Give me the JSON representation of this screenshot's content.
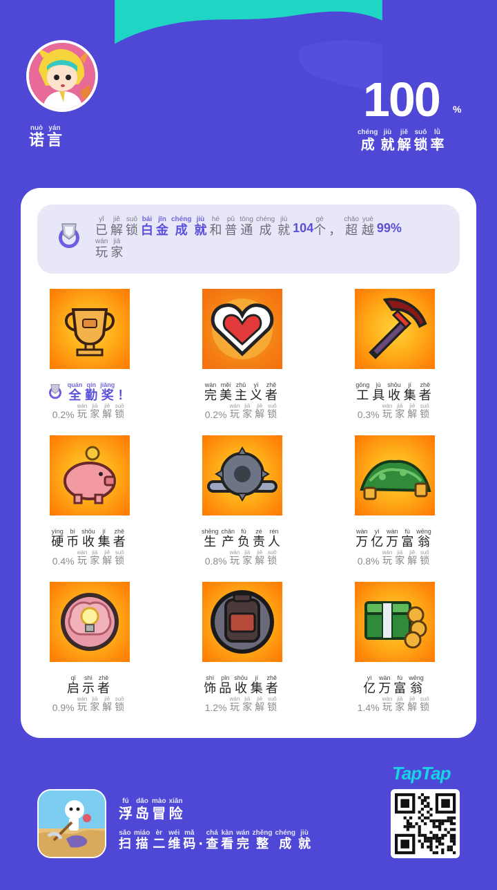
{
  "user": {
    "name": [
      {
        "hz": "诺",
        "py": "nuò"
      },
      {
        "hz": "言",
        "py": "yán"
      }
    ]
  },
  "rate": {
    "value": "100",
    "unit": "%",
    "label": [
      {
        "hz": "成",
        "py": "chéng"
      },
      {
        "hz": "就",
        "py": "jiù"
      },
      {
        "hz": "解",
        "py": "jiě"
      },
      {
        "hz": "锁",
        "py": "suǒ"
      },
      {
        "hz": "率",
        "py": "lǜ"
      }
    ]
  },
  "banner": {
    "seg1": [
      {
        "hz": "已",
        "py": "yǐ"
      },
      {
        "hz": "解",
        "py": "jiě"
      },
      {
        "hz": "锁",
        "py": "suǒ"
      }
    ],
    "seg2": [
      {
        "hz": "白",
        "py": "bái"
      },
      {
        "hz": "金",
        "py": "jīn"
      },
      {
        "hz": "成",
        "py": "chéng"
      },
      {
        "hz": "就",
        "py": "jiù"
      }
    ],
    "seg3": [
      {
        "hz": "和",
        "py": "hé"
      },
      {
        "hz": "普",
        "py": "pǔ"
      },
      {
        "hz": "通",
        "py": "tōng"
      },
      {
        "hz": "成",
        "py": "chéng"
      },
      {
        "hz": "就",
        "py": "jiù"
      }
    ],
    "count": "104",
    "seg4": [
      {
        "hz": "个",
        "py": "gè"
      },
      {
        "hz": "，",
        "py": ""
      }
    ],
    "seg5": [
      {
        "hz": "超",
        "py": "chāo"
      },
      {
        "hz": "越",
        "py": "yuè"
      }
    ],
    "percent": "99%",
    "seg6": [
      {
        "hz": "玩",
        "py": "wán"
      },
      {
        "hz": "家",
        "py": "jiā"
      }
    ]
  },
  "unlock_suffix": [
    {
      "hz": "玩",
      "py": "wán"
    },
    {
      "hz": "家",
      "py": "jiā"
    },
    {
      "hz": "解",
      "py": "jiě"
    },
    {
      "hz": "锁",
      "py": "suǒ"
    }
  ],
  "achievements": [
    {
      "icon": "trophy-icon",
      "special": true,
      "pct": "0.2%",
      "name": [
        {
          "hz": "全",
          "py": "quán"
        },
        {
          "hz": "勤",
          "py": "qín"
        },
        {
          "hz": "奖",
          "py": "jiǎng"
        },
        {
          "hz": "！",
          "py": ""
        }
      ]
    },
    {
      "icon": "heart-icon",
      "special": false,
      "pct": "0.2%",
      "name": [
        {
          "hz": "完",
          "py": "wán"
        },
        {
          "hz": "美",
          "py": "měi"
        },
        {
          "hz": "主",
          "py": "zhǔ"
        },
        {
          "hz": "义",
          "py": "yì"
        },
        {
          "hz": "者",
          "py": "zhě"
        }
      ]
    },
    {
      "icon": "pickaxe-icon",
      "special": false,
      "pct": "0.3%",
      "name": [
        {
          "hz": "工",
          "py": "gōng"
        },
        {
          "hz": "具",
          "py": "jù"
        },
        {
          "hz": "收",
          "py": "shōu"
        },
        {
          "hz": "集",
          "py": "jí"
        },
        {
          "hz": "者",
          "py": "zhě"
        }
      ]
    },
    {
      "icon": "piggy-bank-icon",
      "special": false,
      "pct": "0.4%",
      "name": [
        {
          "hz": "硬",
          "py": "yìng"
        },
        {
          "hz": "币",
          "py": "bì"
        },
        {
          "hz": "收",
          "py": "shōu"
        },
        {
          "hz": "集",
          "py": "jí"
        },
        {
          "hz": "者",
          "py": "zhě"
        }
      ]
    },
    {
      "icon": "gear-wrench-icon",
      "special": false,
      "pct": "0.8%",
      "name": [
        {
          "hz": "生",
          "py": "shēng"
        },
        {
          "hz": "产",
          "py": "chǎn"
        },
        {
          "hz": "负",
          "py": "fù"
        },
        {
          "hz": "责",
          "py": "zé"
        },
        {
          "hz": "人",
          "py": "rén"
        }
      ]
    },
    {
      "icon": "money-pile-icon",
      "special": false,
      "pct": "0.8%",
      "name": [
        {
          "hz": "万",
          "py": "wàn"
        },
        {
          "hz": "亿",
          "py": "yì"
        },
        {
          "hz": "万",
          "py": "wàn"
        },
        {
          "hz": "富",
          "py": "fù"
        },
        {
          "hz": "翁",
          "py": "wēng"
        }
      ]
    },
    {
      "icon": "lightbulb-brain-icon",
      "special": false,
      "pct": "0.9%",
      "name": [
        {
          "hz": "启",
          "py": "qǐ"
        },
        {
          "hz": "示",
          "py": "shì"
        },
        {
          "hz": "者",
          "py": "zhě"
        }
      ]
    },
    {
      "icon": "backpack-icon",
      "special": false,
      "pct": "1.2%",
      "name": [
        {
          "hz": "饰",
          "py": "shì"
        },
        {
          "hz": "品",
          "py": "pǐn"
        },
        {
          "hz": "收",
          "py": "shōu"
        },
        {
          "hz": "集",
          "py": "jí"
        },
        {
          "hz": "者",
          "py": "zhě"
        }
      ]
    },
    {
      "icon": "cash-coins-icon",
      "special": false,
      "pct": "1.4%",
      "name": [
        {
          "hz": "亿",
          "py": "yì"
        },
        {
          "hz": "万",
          "py": "wàn"
        },
        {
          "hz": "富",
          "py": "fù"
        },
        {
          "hz": "翁",
          "py": "wēng"
        }
      ]
    }
  ],
  "footer": {
    "app_name": [
      {
        "hz": "浮",
        "py": "fú"
      },
      {
        "hz": "岛",
        "py": "dǎo"
      },
      {
        "hz": "冒",
        "py": "mào"
      },
      {
        "hz": "险",
        "py": "xiǎn"
      }
    ],
    "scan": [
      {
        "hz": "扫",
        "py": "sǎo"
      },
      {
        "hz": "描",
        "py": "miáo"
      },
      {
        "hz": "二",
        "py": "èr"
      },
      {
        "hz": "维",
        "py": "wéi"
      },
      {
        "hz": "码",
        "py": "mǎ"
      },
      {
        "hz": "·",
        "py": ""
      },
      {
        "hz": "查",
        "py": "chá"
      },
      {
        "hz": "看",
        "py": "kàn"
      },
      {
        "hz": "完",
        "py": "wán"
      },
      {
        "hz": "整",
        "py": "zhěng"
      },
      {
        "hz": "成",
        "py": "chéng"
      },
      {
        "hz": "就",
        "py": "jiù"
      }
    ],
    "brand": "TapTap"
  },
  "colors": {
    "background": "#4f47d6",
    "accent": "#5a4fd8",
    "brand": "#19d3e3",
    "wave": "#1fd6c4"
  }
}
